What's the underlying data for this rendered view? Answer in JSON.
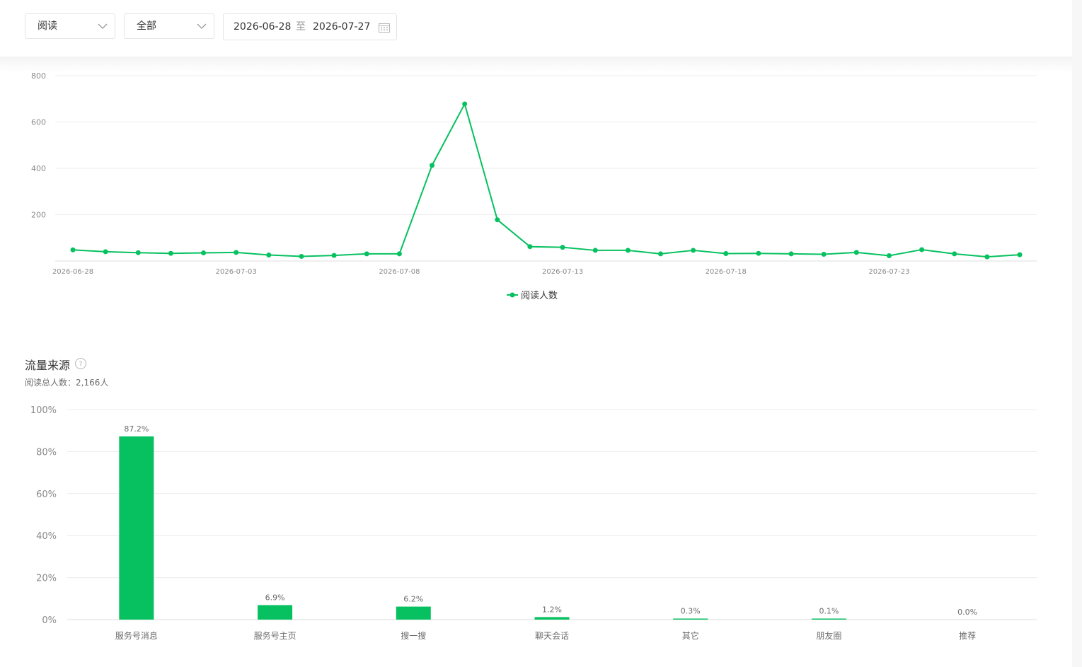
{
  "filters": {
    "metric": "阅读",
    "scope": "全部",
    "date_start": "2026-06-28",
    "date_sep": "至",
    "date_end": "2026-07-27"
  },
  "traffic": {
    "title": "流量来源",
    "total_label": "阅读总人数：",
    "total_value": "2,166人"
  },
  "colors": {
    "accent": "#07c160",
    "grid": "#ececec"
  },
  "icons": {
    "dropdown": "chevron-down-icon",
    "calendar": "calendar-icon",
    "help": "question-circle-icon"
  },
  "chart_data": [
    {
      "type": "line",
      "x": [
        "2026-06-28",
        "2026-06-29",
        "2026-06-30",
        "2026-07-01",
        "2026-07-02",
        "2026-07-03",
        "2026-07-04",
        "2026-07-05",
        "2026-07-06",
        "2026-07-07",
        "2026-07-08",
        "2026-07-09",
        "2026-07-10",
        "2026-07-11",
        "2026-07-12",
        "2026-07-13",
        "2026-07-14",
        "2026-07-15",
        "2026-07-16",
        "2026-07-17",
        "2026-07-18",
        "2026-07-19",
        "2026-07-20",
        "2026-07-21",
        "2026-07-22",
        "2026-07-23",
        "2026-07-24",
        "2026-07-25",
        "2026-07-26",
        "2026-07-27"
      ],
      "x_ticks": [
        "2026-06-28",
        "2026-07-03",
        "2026-07-08",
        "2026-07-13",
        "2026-07-18",
        "2026-07-23"
      ],
      "series": [
        {
          "name": "阅读人数",
          "values": [
            48,
            40,
            36,
            33,
            35,
            37,
            26,
            20,
            24,
            31,
            31,
            413,
            678,
            178,
            62,
            59,
            46,
            46,
            31,
            46,
            32,
            33,
            31,
            29,
            37,
            23,
            49,
            31,
            18,
            27
          ]
        }
      ],
      "y_ticks": [
        200,
        400,
        600,
        800
      ],
      "ylim": [
        0,
        800
      ],
      "grid": true,
      "legend": "bottom-center"
    },
    {
      "type": "bar",
      "categories": [
        "服务号消息",
        "服务号主页",
        "搜一搜",
        "聊天会话",
        "其它",
        "朋友圈",
        "推荐"
      ],
      "values": [
        87.2,
        6.9,
        6.2,
        1.2,
        0.3,
        0.1,
        0.0
      ],
      "labels": [
        "87.2%",
        "6.9%",
        "6.2%",
        "1.2%",
        "0.3%",
        "0.1%",
        "0.0%"
      ],
      "y_ticks": [
        "0%",
        "20%",
        "40%",
        "60%",
        "80%",
        "100%"
      ],
      "ylim": [
        0,
        100
      ],
      "grid": true
    }
  ]
}
